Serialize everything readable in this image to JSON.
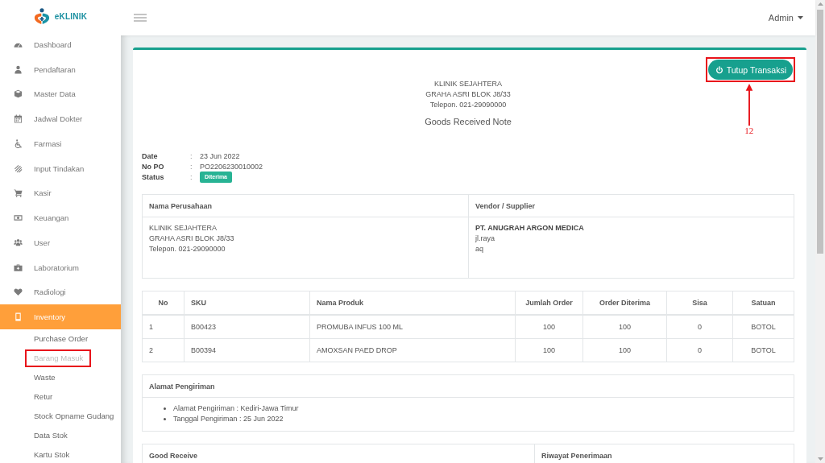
{
  "sidebar": {
    "brand": "eKLINIK",
    "items": [
      {
        "label": "Dashboard",
        "selected": false
      },
      {
        "label": "Pendaftaran",
        "selected": false
      },
      {
        "label": "Master Data",
        "selected": false
      },
      {
        "label": "Jadwal Dokter",
        "selected": false
      },
      {
        "label": "Farmasi",
        "selected": false
      },
      {
        "label": "Input Tindakan",
        "selected": false
      },
      {
        "label": "Kasir",
        "selected": false
      },
      {
        "label": "Keuangan",
        "selected": false
      },
      {
        "label": "User",
        "selected": false
      },
      {
        "label": "Laboratorium",
        "selected": false
      },
      {
        "label": "Radiologi",
        "selected": false
      },
      {
        "label": "Inventory",
        "selected": true,
        "children": [
          {
            "label": "Purchase Order",
            "selected": false,
            "highlighted": false
          },
          {
            "label": "Barang Masuk",
            "selected": true,
            "highlighted": true
          },
          {
            "label": "Waste",
            "selected": false,
            "highlighted": false
          },
          {
            "label": "Retur",
            "selected": false,
            "highlighted": false
          },
          {
            "label": "Stock Opname Gudang",
            "selected": false,
            "highlighted": false
          },
          {
            "label": "Data Stok",
            "selected": false,
            "highlighted": false
          },
          {
            "label": "Kartu Stok",
            "selected": false,
            "highlighted": false
          }
        ]
      }
    ]
  },
  "header": {
    "user": "Admin"
  },
  "document": {
    "close_button": {
      "label": "Tutup Transaksi",
      "highlighted": true,
      "annotation": {
        "label": "12"
      }
    },
    "letterhead": {
      "lines": [
        "KLINIK SEJAHTERA",
        "GRAHA ASRI BLOK J8/33",
        "Telepon. 021-29090000"
      ],
      "title": "Goods Received Note"
    },
    "info": [
      {
        "label": "Date",
        "separator": ":",
        "value": "23 Jun 2022",
        "kind": "text"
      },
      {
        "label": "No PO",
        "separator": ":",
        "value": "PO2206230010002",
        "kind": "text"
      },
      {
        "label": "Status",
        "separator": ":",
        "value": "Diterima",
        "kind": "badge"
      }
    ],
    "parties": [
      {
        "heading": "Nama Perusahaan",
        "lines": [
          "KLINIK SEJAHTERA",
          "GRAHA ASRI BLOK J8/33",
          "Telepon. 021-29090000"
        ]
      },
      {
        "heading": "Vendor / Supplier",
        "name": "PT. ANUGRAH ARGON MEDICA",
        "lines": [
          "jl.raya",
          "aq"
        ]
      }
    ],
    "items_table": {
      "columns": [
        "No",
        "SKU",
        "Nama Produk",
        "Jumlah Order",
        "Order Diterima",
        "Sisa",
        "Satuan"
      ],
      "rows": [
        [
          "1",
          "B00423",
          "PROMUBA INFUS 100 ML",
          "100",
          "100",
          "0",
          "BOTOL"
        ],
        [
          "2",
          "B00394",
          "AMOXSAN PAED DROP",
          "100",
          "100",
          "0",
          "BOTOL"
        ]
      ]
    },
    "shipping": {
      "heading": "Alamat Pengiriman",
      "lines": [
        "Alamat Pengiriman : Kediri-Jawa Timur",
        "Tanggal Pengiriman : 25 Jun 2022"
      ]
    },
    "receive": {
      "columns": [
        "Good Receive",
        "Riwayat Penerimaan"
      ]
    }
  }
}
